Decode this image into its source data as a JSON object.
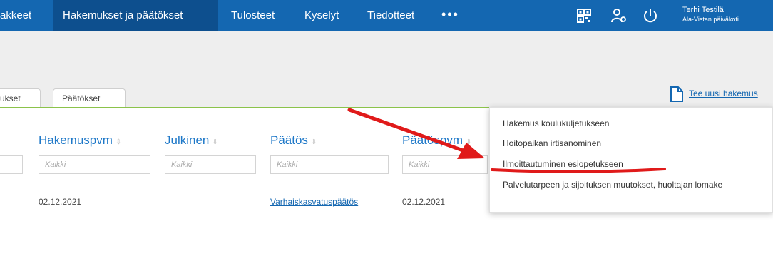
{
  "nav": {
    "items": [
      "akkeet",
      "Hakemukset ja päätökset",
      "Tulosteet",
      "Kyselyt",
      "Tiedotteet"
    ],
    "more": "•••"
  },
  "user": {
    "name": "Terhi Testilä",
    "org": "Ala-Vistan päiväkoti"
  },
  "tabs": [
    "ukset",
    "Päätökset"
  ],
  "new_application": {
    "label": "Tee uusi hakemus"
  },
  "columns": [
    {
      "header": "Hakemuspvm",
      "filter_placeholder": "Kaikki"
    },
    {
      "header": "Julkinen",
      "filter_placeholder": "Kaikki"
    },
    {
      "header": "Päätös",
      "filter_placeholder": "Kaikki"
    },
    {
      "header": "Päätöspvm",
      "filter_placeholder": "Kaikki"
    }
  ],
  "row": {
    "application_date": "02.12.2021",
    "decision": "Varhaiskasvatuspäätös",
    "decision_date": "02.12.2021"
  },
  "dropdown": {
    "items": [
      "Hakemus koulukuljetukseen",
      "Hoitopaikan irtisanominen",
      "Ilmoittautuminen esiopetukseen",
      "Palvelutarpeen ja sijoituksen muutokset, huoltajan lomake"
    ]
  },
  "colors": {
    "nav_bg": "#1467b1",
    "nav_active": "#0d4f8e",
    "annotation": "#e01a1a",
    "tab_line": "#8bc34a"
  },
  "annotation": {
    "highlighted_item": "Ilmoittautuminen esiopetukseen"
  }
}
